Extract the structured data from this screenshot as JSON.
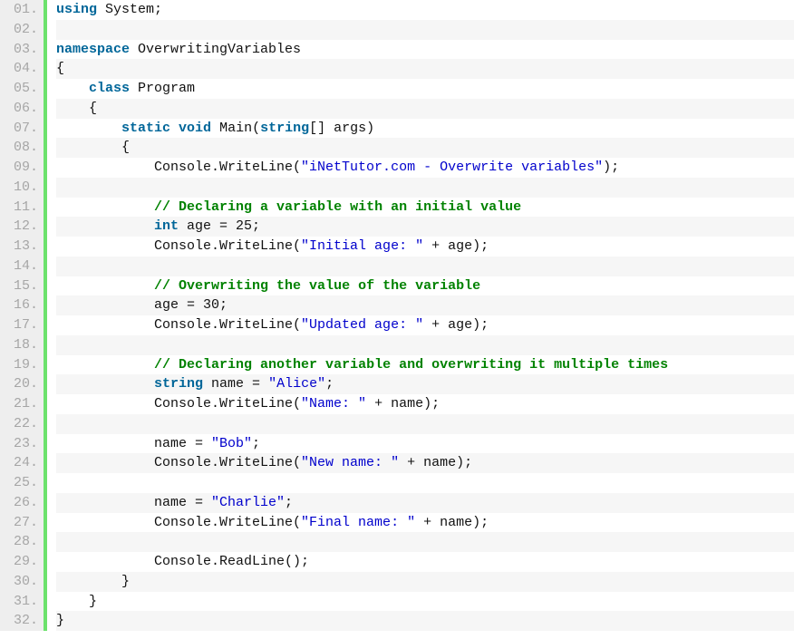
{
  "code": {
    "lines": [
      {
        "n": "01.",
        "segments": [
          {
            "cls": "kw",
            "t": "using"
          },
          {
            "cls": "txt",
            "t": " System;"
          }
        ]
      },
      {
        "n": "02.",
        "segments": []
      },
      {
        "n": "03.",
        "segments": [
          {
            "cls": "kw",
            "t": "namespace"
          },
          {
            "cls": "txt",
            "t": " OverwritingVariables"
          }
        ]
      },
      {
        "n": "04.",
        "segments": [
          {
            "cls": "txt",
            "t": "{"
          }
        ]
      },
      {
        "n": "05.",
        "segments": [
          {
            "cls": "txt",
            "t": "    "
          },
          {
            "cls": "kw",
            "t": "class"
          },
          {
            "cls": "txt",
            "t": " Program"
          }
        ]
      },
      {
        "n": "06.",
        "segments": [
          {
            "cls": "txt",
            "t": "    {"
          }
        ]
      },
      {
        "n": "07.",
        "segments": [
          {
            "cls": "txt",
            "t": "        "
          },
          {
            "cls": "kw",
            "t": "static"
          },
          {
            "cls": "txt",
            "t": " "
          },
          {
            "cls": "kw",
            "t": "void"
          },
          {
            "cls": "txt",
            "t": " Main("
          },
          {
            "cls": "kw",
            "t": "string"
          },
          {
            "cls": "txt",
            "t": "[] args)"
          }
        ]
      },
      {
        "n": "08.",
        "segments": [
          {
            "cls": "txt",
            "t": "        {"
          }
        ]
      },
      {
        "n": "09.",
        "segments": [
          {
            "cls": "txt",
            "t": "            Console.WriteLine("
          },
          {
            "cls": "str",
            "t": "\"iNetTutor.com - Overwrite variables\""
          },
          {
            "cls": "txt",
            "t": ");"
          }
        ]
      },
      {
        "n": "10.",
        "segments": []
      },
      {
        "n": "11.",
        "segments": [
          {
            "cls": "txt",
            "t": "            "
          },
          {
            "cls": "cmt",
            "t": "// Declaring a variable with an initial value"
          }
        ]
      },
      {
        "n": "12.",
        "segments": [
          {
            "cls": "txt",
            "t": "            "
          },
          {
            "cls": "kw",
            "t": "int"
          },
          {
            "cls": "txt",
            "t": " age = 25;"
          }
        ]
      },
      {
        "n": "13.",
        "segments": [
          {
            "cls": "txt",
            "t": "            Console.WriteLine("
          },
          {
            "cls": "str",
            "t": "\"Initial age: \""
          },
          {
            "cls": "txt",
            "t": " + age);"
          }
        ]
      },
      {
        "n": "14.",
        "segments": []
      },
      {
        "n": "15.",
        "segments": [
          {
            "cls": "txt",
            "t": "            "
          },
          {
            "cls": "cmt",
            "t": "// Overwriting the value of the variable"
          }
        ]
      },
      {
        "n": "16.",
        "segments": [
          {
            "cls": "txt",
            "t": "            age = 30;"
          }
        ]
      },
      {
        "n": "17.",
        "segments": [
          {
            "cls": "txt",
            "t": "            Console.WriteLine("
          },
          {
            "cls": "str",
            "t": "\"Updated age: \""
          },
          {
            "cls": "txt",
            "t": " + age);"
          }
        ]
      },
      {
        "n": "18.",
        "segments": []
      },
      {
        "n": "19.",
        "segments": [
          {
            "cls": "txt",
            "t": "            "
          },
          {
            "cls": "cmt",
            "t": "// Declaring another variable and overwriting it multiple times"
          }
        ]
      },
      {
        "n": "20.",
        "segments": [
          {
            "cls": "txt",
            "t": "            "
          },
          {
            "cls": "kw",
            "t": "string"
          },
          {
            "cls": "txt",
            "t": " name = "
          },
          {
            "cls": "str",
            "t": "\"Alice\""
          },
          {
            "cls": "txt",
            "t": ";"
          }
        ]
      },
      {
        "n": "21.",
        "segments": [
          {
            "cls": "txt",
            "t": "            Console.WriteLine("
          },
          {
            "cls": "str",
            "t": "\"Name: \""
          },
          {
            "cls": "txt",
            "t": " + name);"
          }
        ]
      },
      {
        "n": "22.",
        "segments": []
      },
      {
        "n": "23.",
        "segments": [
          {
            "cls": "txt",
            "t": "            name = "
          },
          {
            "cls": "str",
            "t": "\"Bob\""
          },
          {
            "cls": "txt",
            "t": ";"
          }
        ]
      },
      {
        "n": "24.",
        "segments": [
          {
            "cls": "txt",
            "t": "            Console.WriteLine("
          },
          {
            "cls": "str",
            "t": "\"New name: \""
          },
          {
            "cls": "txt",
            "t": " + name);"
          }
        ]
      },
      {
        "n": "25.",
        "segments": []
      },
      {
        "n": "26.",
        "segments": [
          {
            "cls": "txt",
            "t": "            name = "
          },
          {
            "cls": "str",
            "t": "\"Charlie\""
          },
          {
            "cls": "txt",
            "t": ";"
          }
        ]
      },
      {
        "n": "27.",
        "segments": [
          {
            "cls": "txt",
            "t": "            Console.WriteLine("
          },
          {
            "cls": "str",
            "t": "\"Final name: \""
          },
          {
            "cls": "txt",
            "t": " + name);"
          }
        ]
      },
      {
        "n": "28.",
        "segments": []
      },
      {
        "n": "29.",
        "segments": [
          {
            "cls": "txt",
            "t": "            Console.ReadLine();"
          }
        ]
      },
      {
        "n": "30.",
        "segments": [
          {
            "cls": "txt",
            "t": "        }"
          }
        ]
      },
      {
        "n": "31.",
        "segments": [
          {
            "cls": "txt",
            "t": "    }"
          }
        ]
      },
      {
        "n": "32.",
        "segments": [
          {
            "cls": "txt",
            "t": "}"
          }
        ]
      }
    ]
  }
}
